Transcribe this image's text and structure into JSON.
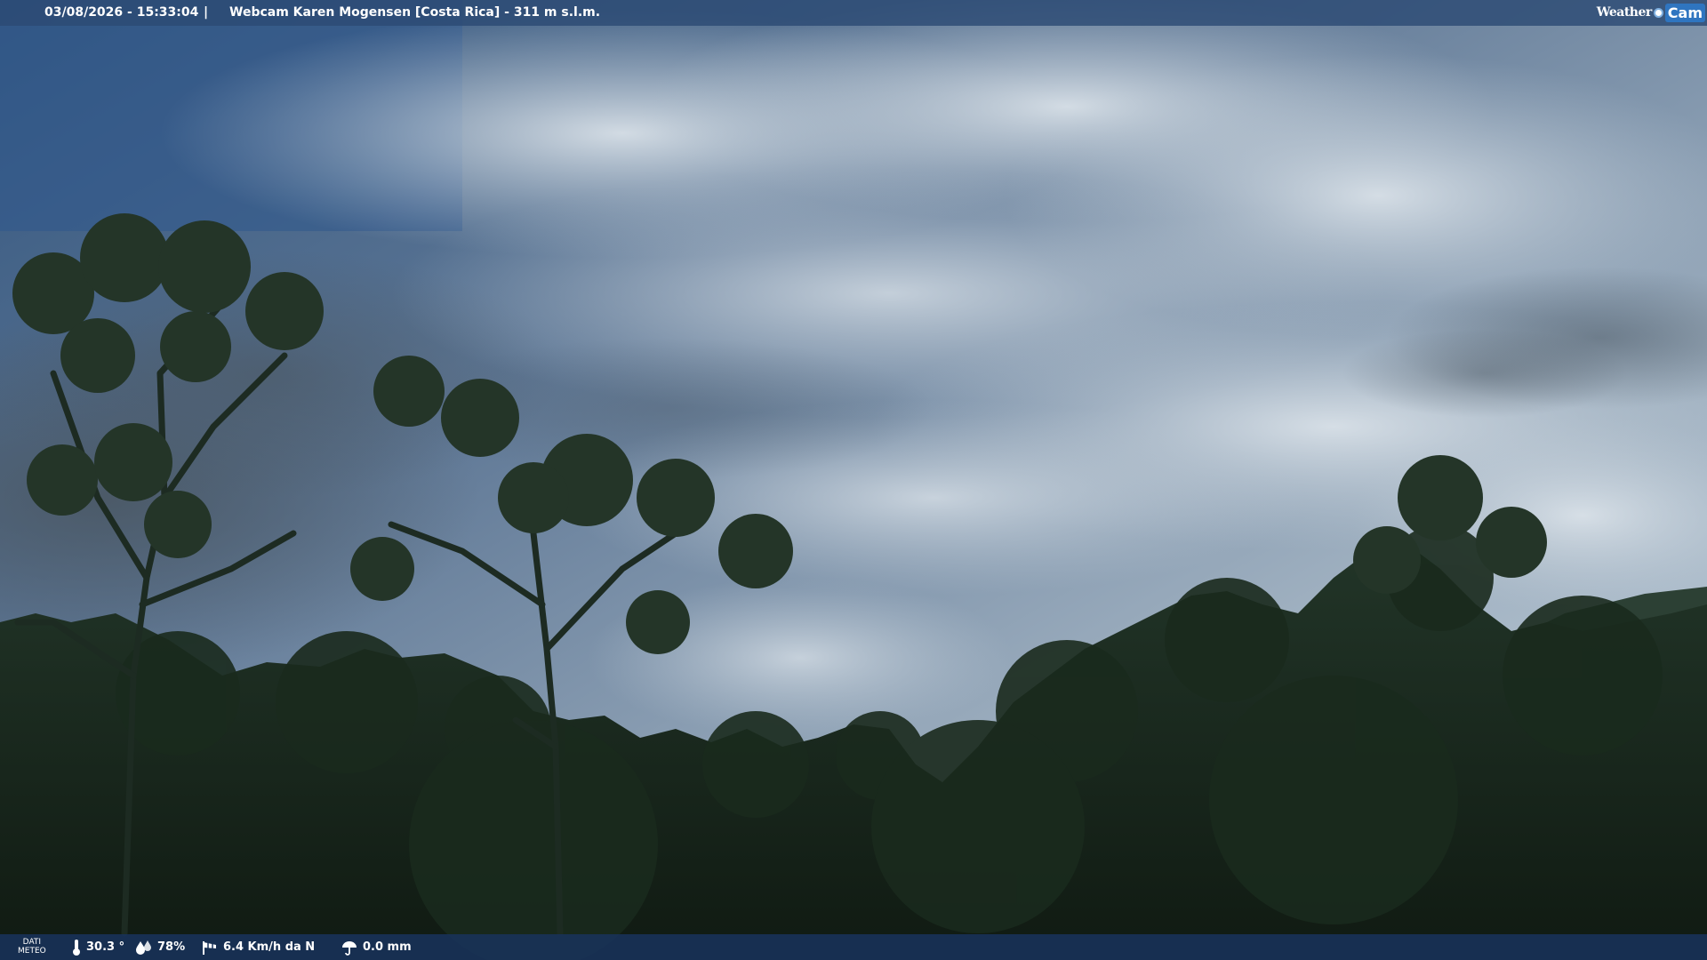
{
  "header": {
    "datetime": "03/08/2026 - 15:33:04",
    "separator": "|",
    "title": "Webcam Karen Mogensen [Costa Rica] - 311 m s.l.m."
  },
  "logo": {
    "part1": "Weather",
    "part2": "Cam"
  },
  "weather": {
    "label_line1": "DATI",
    "label_line2": "METEO",
    "temperature": "30.3 °",
    "humidity": "78%",
    "wind": "6.4 Km/h da N",
    "rain": "0.0 mm"
  },
  "colors": {
    "bar_top": "#2c4a74",
    "bar_bottom": "#18325a",
    "sky_blue": "#3a6aa6",
    "cloud": "#c9d3dc",
    "forest": "#1c2c20"
  }
}
